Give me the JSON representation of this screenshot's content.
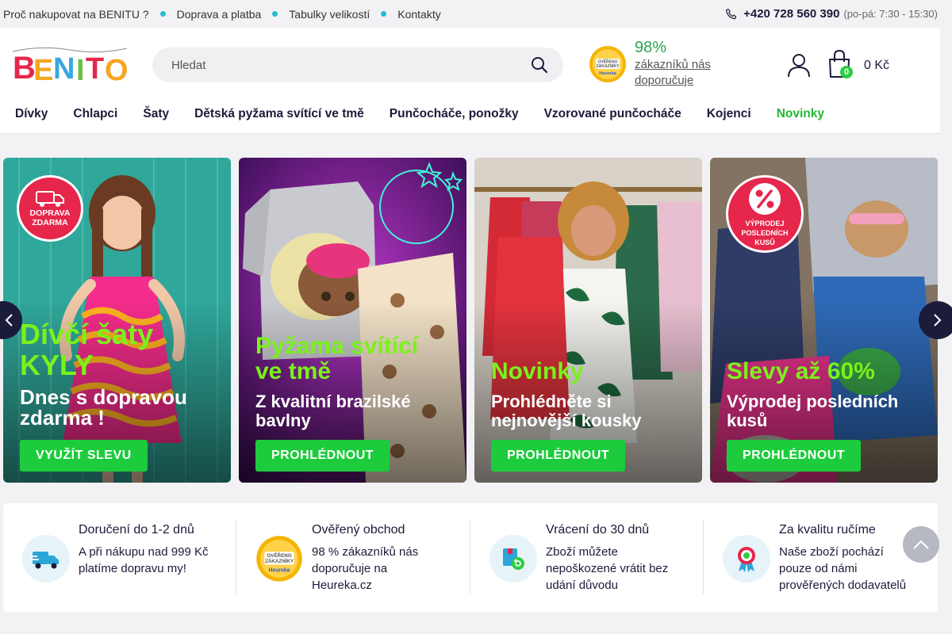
{
  "topbar": {
    "links": [
      "Proč nakupovat na BENITU ?",
      "Doprava a platba",
      "Tabulky velikostí",
      "Kontakty"
    ],
    "phone": "+420 728 560 390",
    "hours": "(po-pá: 7:30 - 15:30)"
  },
  "header": {
    "logo_text": "BENITO",
    "search_placeholder": "Hledat",
    "rating_percent": "98%",
    "rating_text": "zákazníků nás doporučuje",
    "heureka_badge": "OVĚŘENO ZÁKAZNÍKY",
    "heureka_brand": "Heureka",
    "cart_count": "0",
    "cart_price": "0 Kč"
  },
  "nav": [
    "Dívky",
    "Chlapci",
    "Šaty",
    "Dětská pyžama svítící ve tmě",
    "Punčocháče, ponožky",
    "Vzorované punčocháče",
    "Kojenci",
    "Novinky"
  ],
  "banners": [
    {
      "title": "Dívčí šaty KYLY",
      "subtitle": "Dnes s dopravou zdarma !",
      "cta": "VYUŽÍT SLEVU",
      "badge": "DOPRAVA ZDARMA"
    },
    {
      "title": "Pyžama svítící ve tmě",
      "subtitle": "Z kvalitní brazilské bavlny",
      "cta": "PROHLÉDNOUT"
    },
    {
      "title": "Novinky",
      "subtitle": "Prohlédněte si nejnovější kousky",
      "cta": "PROHLÉDNOUT"
    },
    {
      "title": "Slevy až 60%",
      "subtitle": "Výprodej posledních kusů",
      "cta": "PROHLÉDNOUT",
      "badge": "VÝPRODEJ POSLEDNÍCH KUSŮ"
    }
  ],
  "features": [
    {
      "title": "Doručení do 1-2 dnů",
      "text": "A při nákupu nad 999 Kč platíme dopravu my!"
    },
    {
      "title": "Ověřený obchod",
      "text": "98 % zákazníků nás doporučuje na Heureka.cz"
    },
    {
      "title": "Vrácení do 30 dnů",
      "text": "Zboží můžete nepoškozené vrátit bez udání důvodu"
    },
    {
      "title": "Za kvalitu ručíme",
      "text": "Naše zboží pochází pouze od námi prověřených dodavatelů"
    }
  ],
  "colors": {
    "accent_green": "#1ccc3c",
    "title_green": "#7af21a",
    "nav_green": "#22b833",
    "dot_teal": "#22bcd2",
    "navy": "#1b1b3a"
  }
}
